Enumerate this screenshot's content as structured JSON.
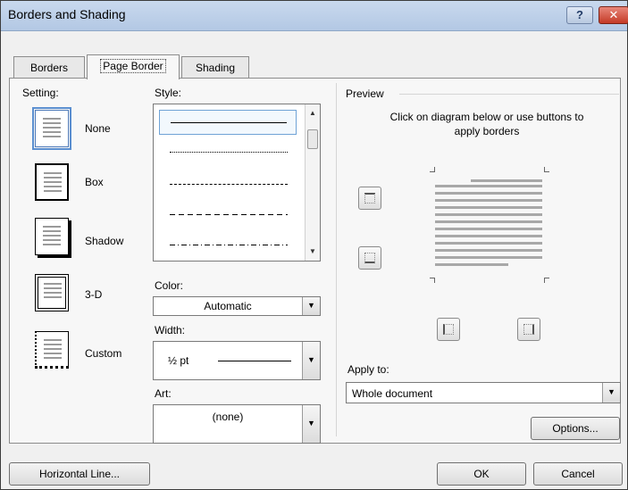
{
  "window": {
    "title": "Borders and Shading",
    "help_glyph": "?",
    "close_glyph": "✕"
  },
  "tabs": [
    {
      "label": "Borders"
    },
    {
      "label": "Page Border"
    },
    {
      "label": "Shading"
    }
  ],
  "setting": {
    "label": "Setting:",
    "items": [
      {
        "label": "None"
      },
      {
        "label": "Box"
      },
      {
        "label": "Shadow"
      },
      {
        "label": "3-D"
      },
      {
        "label": "Custom"
      }
    ]
  },
  "style": {
    "label": "Style:",
    "items": [
      "solid",
      "dotted",
      "dashed-small",
      "dashed",
      "dash-dot"
    ]
  },
  "color": {
    "label": "Color:",
    "value": "Automatic"
  },
  "width": {
    "label": "Width:",
    "value": "½ pt"
  },
  "art": {
    "label": "Art:",
    "value": "(none)"
  },
  "preview": {
    "label": "Preview",
    "help": "Click on diagram below or use buttons to apply borders"
  },
  "apply_to": {
    "label": "Apply to:",
    "value": "Whole document"
  },
  "buttons": {
    "options": "Options...",
    "horizontal_line": "Horizontal Line...",
    "ok": "OK",
    "cancel": "Cancel"
  },
  "icons": {
    "dropdown": "▼",
    "scroll_up": "▲",
    "scroll_down": "▼"
  },
  "colors": {
    "titlebar": "#c2d4ec",
    "selection_blue": "#5b8fd0",
    "dialog_bg": "#f0f0f0"
  }
}
